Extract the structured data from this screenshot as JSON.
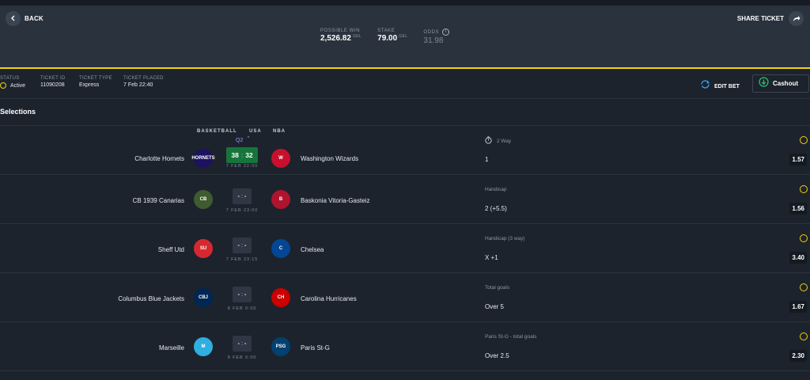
{
  "header": {
    "back_label": "BACK",
    "share_label": "SHARE TICKET",
    "possible_win": {
      "label": "POSSIBLE WIN",
      "value": "2,526.82",
      "currency": "GEL"
    },
    "stake": {
      "label": "STAKE",
      "value": "79.00",
      "currency": "GEL"
    },
    "odds": {
      "label": "ODDS",
      "value": "31.98"
    }
  },
  "ticket": {
    "status": {
      "label": "STATUS",
      "value": "Active"
    },
    "ticket_id": {
      "label": "TICKET ID",
      "value": "11090208"
    },
    "ticket_type": {
      "label": "TICKET TYPE",
      "value": "Express"
    },
    "ticket_placed": {
      "label": "TICKET PLACED",
      "value": "7 Feb 22:40"
    },
    "edit_label": "EDIT BET",
    "cashout_label": "Cashout"
  },
  "selections_title": "Selections",
  "competition": {
    "sport": "BASKETBALL",
    "country": "USA",
    "league": "NBA"
  },
  "selections": [
    {
      "home": "Charlotte Hornets",
      "away": "Washington Wizards",
      "home_logo": "HORNETS",
      "away_logo": "W",
      "home_color": "#1d1160",
      "away_color": "#c8102e",
      "score_home": "38",
      "score_sep": ":",
      "score_away": "32",
      "period": "Q2",
      "period_mark": "*",
      "live": true,
      "kickoff": "7 FEB 22:00",
      "market": "2 Way",
      "timed": true,
      "pick": "1",
      "odds": "1.57"
    },
    {
      "home": "CB 1939 Canarias",
      "away": "Baskonia Vitoria-Gasteiz",
      "home_logo": "CB",
      "away_logo": "B",
      "home_color": "#3e5c2f",
      "away_color": "#b0132d",
      "score_home": "-",
      "score_sep": ":",
      "score_away": "-",
      "live": false,
      "kickoff": "7 FEB 23:00",
      "market": "Handicap",
      "timed": false,
      "pick": "2 (+5.5)",
      "odds": "1.56"
    },
    {
      "home": "Sheff Utd",
      "away": "Chelsea",
      "home_logo": "SU",
      "away_logo": "C",
      "home_color": "#d7282f",
      "away_color": "#034694",
      "score_home": "-",
      "score_sep": ":",
      "score_away": "-",
      "live": false,
      "kickoff": "7 FEB 23:15",
      "market": "Handicap (3 way)",
      "timed": false,
      "pick": "X +1",
      "odds": "3.40"
    },
    {
      "home": "Columbus Blue Jackets",
      "away": "Carolina Hurricanes",
      "home_logo": "CBJ",
      "away_logo": "CH",
      "home_color": "#002654",
      "away_color": "#cc0000",
      "score_home": "-",
      "score_sep": ":",
      "score_away": "-",
      "live": false,
      "kickoff": "8 FEB 0:00",
      "market": "Total goals",
      "timed": false,
      "pick": "Over 5",
      "odds": "1.67"
    },
    {
      "home": "Marseille",
      "away": "Paris St-G",
      "home_logo": "M",
      "away_logo": "PSG",
      "home_color": "#2faee0",
      "away_color": "#004170",
      "score_home": "-",
      "score_sep": ":",
      "score_away": "-",
      "live": false,
      "kickoff": "8 FEB 0:00",
      "market": "Paris St-G - total goals",
      "timed": false,
      "pick": "Over 2.5",
      "odds": "2.30"
    }
  ],
  "colors": {
    "accent": "#f2d30b",
    "live_score": "#17753b",
    "background": "#1c232d",
    "header": "#2a323d"
  },
  "icons": {
    "back": "chevron-left-icon",
    "share": "share-arrow-icon",
    "info": "info-icon",
    "edit": "refresh-edit-icon",
    "cashout": "download-circle-icon",
    "timer": "stopwatch-icon"
  }
}
